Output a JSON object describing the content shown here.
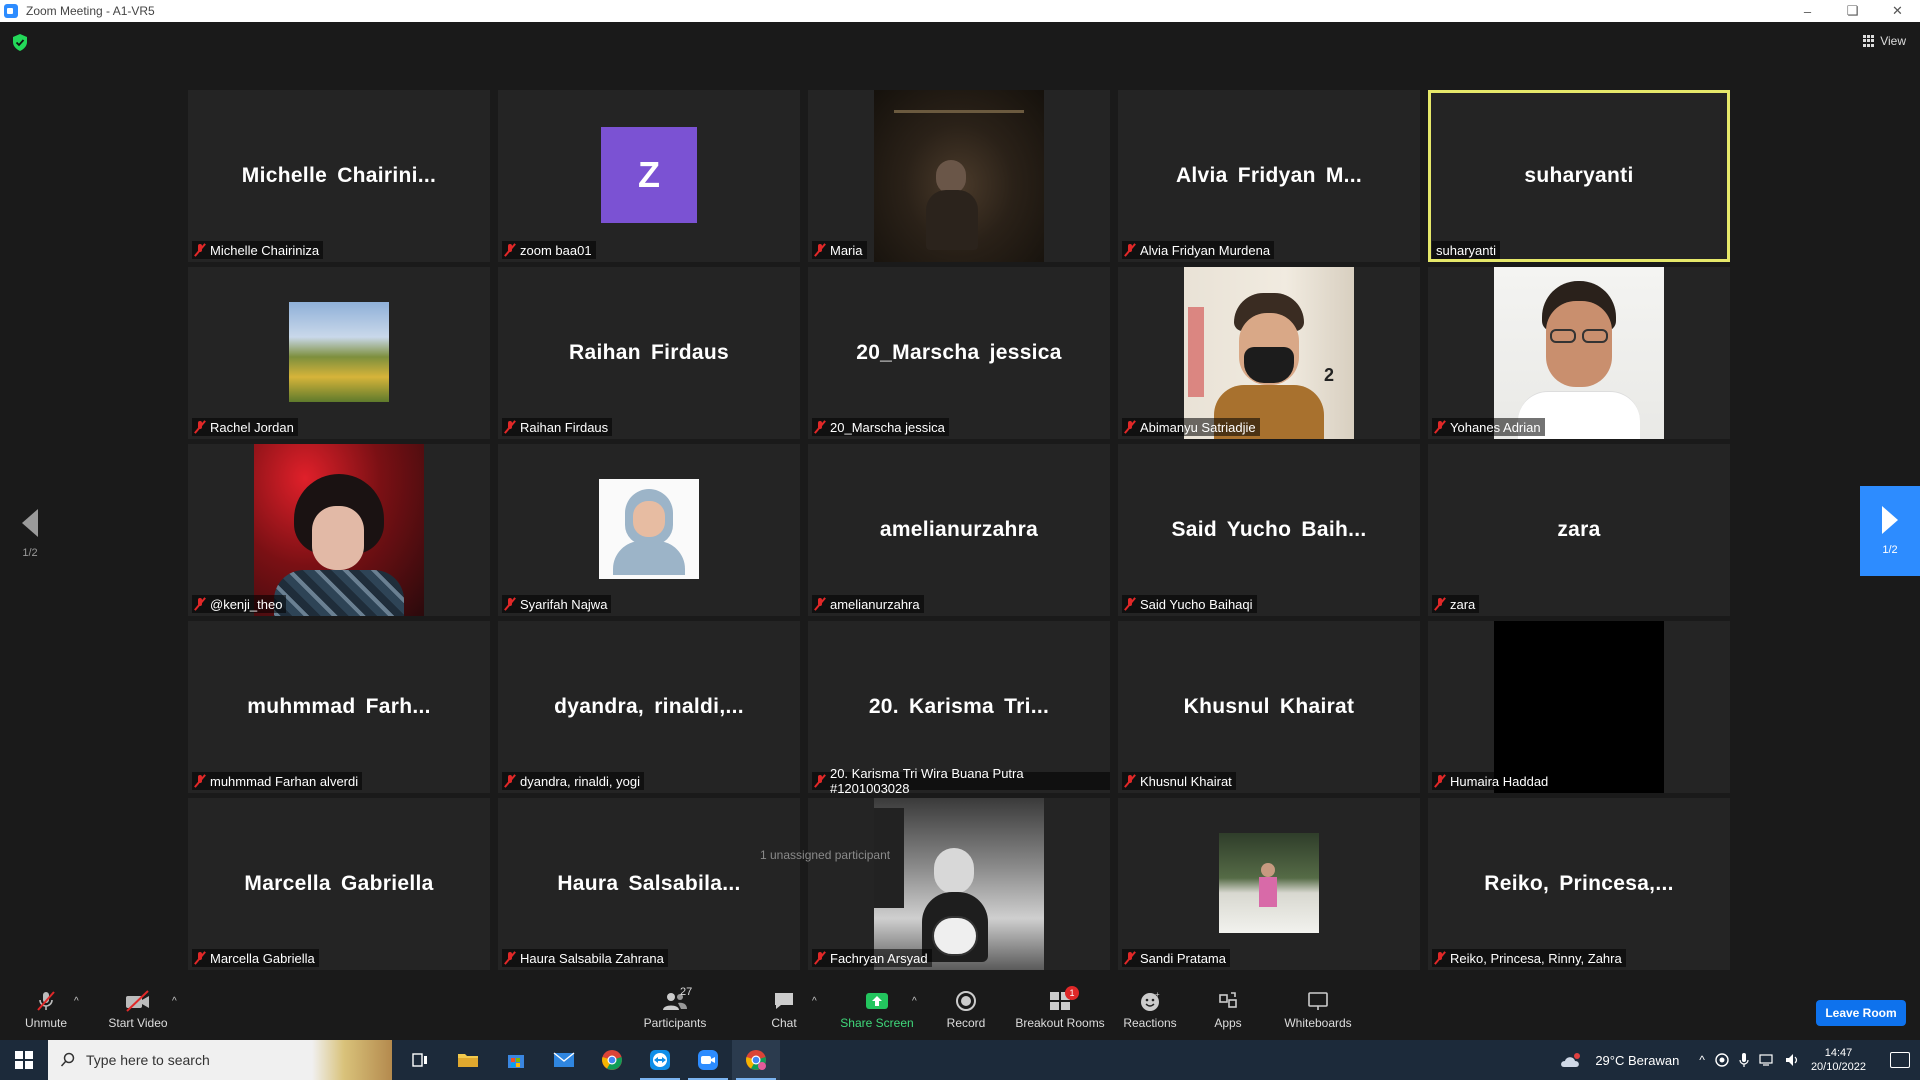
{
  "window": {
    "title": "Zoom Meeting - A1-VR5",
    "controls": [
      "minimize",
      "maximize",
      "close"
    ]
  },
  "top_bar": {
    "security_icon": "shield-check-icon",
    "view_label": "View"
  },
  "pagination": {
    "left_page": "1/2",
    "right_page": "1/2"
  },
  "tiles": [
    {
      "big": "Michelle  Chairini...",
      "label": "Michelle Chairiniza",
      "muted": true,
      "media": "none"
    },
    {
      "big": "",
      "label": "zoom baa01",
      "muted": true,
      "media": "avatar",
      "avatar_letter": "Z"
    },
    {
      "big": "",
      "label": "Maria",
      "muted": true,
      "media": "video"
    },
    {
      "big": "Alvia  Fridyan  M...",
      "label": "Alvia Fridyan Murdena",
      "muted": true,
      "media": "none"
    },
    {
      "big": "suharyanti",
      "label": "suharyanti",
      "muted": false,
      "media": "none",
      "active": true
    },
    {
      "big": "",
      "label": "Rachel Jordan",
      "muted": true,
      "media": "photo"
    },
    {
      "big": "Raihan Firdaus",
      "label": "Raihan Firdaus",
      "muted": true,
      "media": "none"
    },
    {
      "big": "20_Marscha jessica",
      "label": "20_Marscha jessica",
      "muted": true,
      "media": "none"
    },
    {
      "big": "",
      "label": "Abimanyu Satriadjie",
      "muted": true,
      "media": "video"
    },
    {
      "big": "",
      "label": "Yohanes Adrian",
      "muted": true,
      "media": "video"
    },
    {
      "big": "",
      "label": "@kenji_theo",
      "muted": true,
      "media": "video"
    },
    {
      "big": "",
      "label": "Syarifah Najwa",
      "muted": true,
      "media": "photo"
    },
    {
      "big": "amelianurzahra",
      "label": "amelianurzahra",
      "muted": true,
      "media": "none"
    },
    {
      "big": "Said  Yucho  Baih...",
      "label": "Said Yucho Baihaqi",
      "muted": true,
      "media": "none"
    },
    {
      "big": "zara",
      "label": "zara",
      "muted": true,
      "media": "none"
    },
    {
      "big": "muhmmad  Farh...",
      "label": "muhmmad Farhan alverdi",
      "muted": true,
      "media": "none"
    },
    {
      "big": "dyandra,  rinaldi,...",
      "label": "dyandra, rinaldi, yogi",
      "muted": true,
      "media": "none"
    },
    {
      "big": "20.  Karisma  Tri...",
      "label": "20. Karisma Tri Wira Buana Putra #1201003028",
      "muted": true,
      "media": "none"
    },
    {
      "big": "Khusnul Khairat",
      "label": "Khusnul Khairat",
      "muted": true,
      "media": "none"
    },
    {
      "big": "",
      "label": "Humaira Haddad",
      "muted": true,
      "media": "black"
    },
    {
      "big": "Marcella Gabriella",
      "label": "Marcella Gabriella",
      "muted": true,
      "media": "none"
    },
    {
      "big": "Haura  Salsabila...",
      "label": "Haura Salsabila Zahrana",
      "muted": true,
      "media": "none"
    },
    {
      "big": "",
      "label": "Fachryan Arsyad",
      "muted": true,
      "media": "video"
    },
    {
      "big": "",
      "label": "Sandi Pratama",
      "muted": true,
      "media": "photo"
    },
    {
      "big": "Reiko,  Princesa,...",
      "label": "Reiko, Princesa, Rinny, Zahra",
      "muted": true,
      "media": "none"
    }
  ],
  "overlay": {
    "unassigned": "1 unassigned participant"
  },
  "toolbar": {
    "unmute": "Unmute",
    "start_video": "Start Video",
    "participants": "Participants",
    "participants_count": "27",
    "chat": "Chat",
    "share_screen": "Share Screen",
    "record": "Record",
    "breakout_rooms": "Breakout Rooms",
    "breakout_badge": "1",
    "reactions": "Reactions",
    "apps": "Apps",
    "whiteboards": "Whiteboards",
    "leave": "Leave Room"
  },
  "taskbar": {
    "search_placeholder": "Type here to search",
    "weather": "29°C  Berawan",
    "time": "14:47",
    "date": "20/10/2022"
  },
  "colors": {
    "accent": "#2d8cff",
    "active_speaker": "#e6e86a",
    "muted_red": "#e02828",
    "share_green": "#3fd87a",
    "leave_blue": "#0e72ed",
    "avatar_purple": "#7b52d3"
  }
}
